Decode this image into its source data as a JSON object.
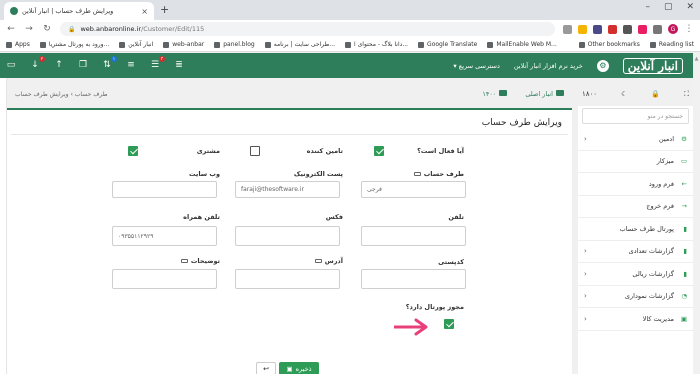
{
  "browser": {
    "tab_title": "ویرایش طرف حساب | انبار آنلاین",
    "url_host": "web.anbaronline.ir",
    "url_path": "/Customer/Edit/115",
    "avatar_letter": "G",
    "bookmarks": [
      "Apps",
      "ورود به پورتال مشتریا...",
      "انبار آنلاین",
      "web-anbar",
      "panel.blog",
      "طراحی سایت | برنامه...",
      "دانا بلاگ - محتوای ا...",
      "Google Translate",
      "MailEnable Web M..."
    ],
    "bookmarks_right": [
      "Other bookmarks",
      "Reading list"
    ]
  },
  "header": {
    "logo": "انبار آنلاین",
    "menu": [
      "خرید نرم افزار انبار آنلاین",
      "دسترسی سریع"
    ],
    "badges": [
      "۲",
      "۱",
      "۳"
    ]
  },
  "breadcrumb": {
    "root": "طرف حساب",
    "current": "ویرایش طرف حساب"
  },
  "inventory": {
    "name": "انبار اصلی",
    "year": "۱۴۰۰"
  },
  "topbar_right": {
    "year": "۱۸۰۰"
  },
  "form": {
    "title": "ویرایش طرف حساب",
    "is_active_label": "آیا فعال است؟",
    "supplier_label": "تامین کننده",
    "customer_label": "مشتری",
    "party_label": "طرف حساب",
    "party_value": "فرجی",
    "email_label": "پست الکترونیک",
    "email_value": "faraji@thesoftware.ir",
    "website_label": "وب سایت",
    "phone_label": "تلفن",
    "fax_label": "فکس",
    "mobile_label": "تلفن همراه",
    "mobile_value": "۰۹۳۵۵۱۱۲۹۲۹",
    "postal_label": "کدپستی",
    "address_label": "آدرس",
    "notes_label": "توضیحات",
    "portal_label": "مجوز پورتال دارد؟",
    "save_label": "ذخیره",
    "back_label": "↩"
  },
  "sidebar": {
    "search_placeholder": "جستجو در منو",
    "items": [
      {
        "label": "ادمین",
        "color": "#2e9b56"
      },
      {
        "label": "میزکار",
        "color": "#2e9b56"
      },
      {
        "label": "فرم ورود",
        "color": "#2e9b56"
      },
      {
        "label": "فرم خروج",
        "color": "#2e9b56"
      },
      {
        "label": "پورتال طرف حساب",
        "color": "#2e9b56"
      },
      {
        "label": "گزارشات تعدادی",
        "color": "#2e9b56"
      },
      {
        "label": "گزارشات ریالی",
        "color": "#2e9b56"
      },
      {
        "label": "گزارشات نموداری",
        "color": "#2e9b56"
      },
      {
        "label": "مدیریت کالا",
        "color": "#2e9b56"
      }
    ]
  },
  "colors": {
    "brand": "#2e7d5b",
    "accent": "#2e9b56",
    "arrow": "#e8407a"
  }
}
